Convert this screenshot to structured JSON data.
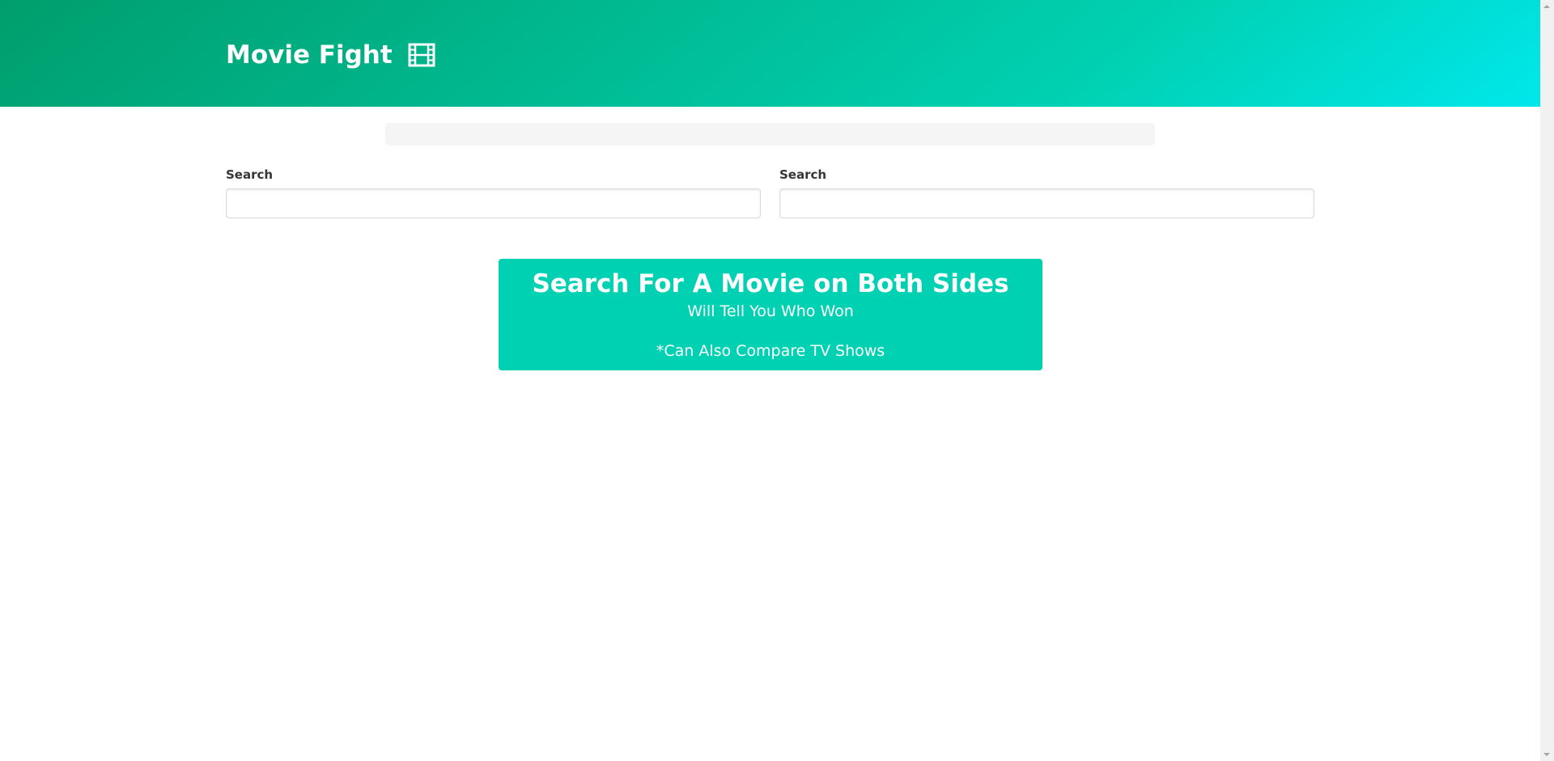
{
  "header": {
    "title": "Movie Fight",
    "icon": "film-icon",
    "gradient_colors": [
      "#009e6c",
      "#00d1b2",
      "#00e7eb"
    ]
  },
  "search": {
    "left": {
      "label": "Search",
      "value": "",
      "placeholder": ""
    },
    "right": {
      "label": "Search",
      "value": "",
      "placeholder": ""
    }
  },
  "tutorial": {
    "title": "Search For A Movie on Both Sides",
    "subtitle": "Will Tell You Who Won",
    "note": "*Can Also Compare TV Shows",
    "color": "#00d1b2"
  },
  "scrollbar": {
    "up_icon": "scroll-up-arrow-icon",
    "down_icon": "scroll-down-arrow-icon"
  }
}
